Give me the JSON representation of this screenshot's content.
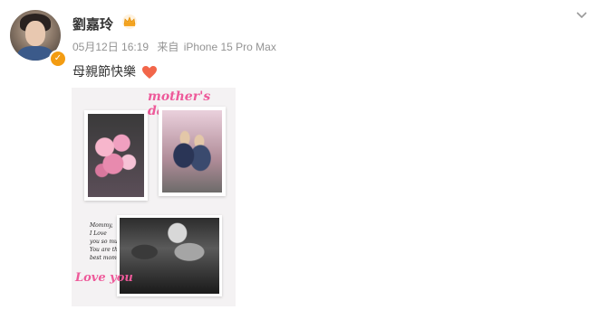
{
  "post": {
    "author": "劉嘉玲",
    "date": "05月12日 16:19",
    "source_prefix": "来自",
    "device": "iPhone 15 Pro Max",
    "text": "母親節快樂",
    "heart_emoji": "❤"
  },
  "photo": {
    "title": "mother's day",
    "note_lines": [
      "Mommy,",
      "I Love",
      "you so much",
      "You are the",
      "best mom"
    ],
    "love_you": "Love you"
  },
  "icons": {
    "menu": "chevron-down-icon",
    "verified": "verified-badge-icon",
    "crown": "crown-icon",
    "heart": "heart-icon"
  },
  "colors": {
    "accent_pink": "#ee5a9a",
    "meta_gray": "#939393",
    "verified_orange": "#f39c12"
  }
}
